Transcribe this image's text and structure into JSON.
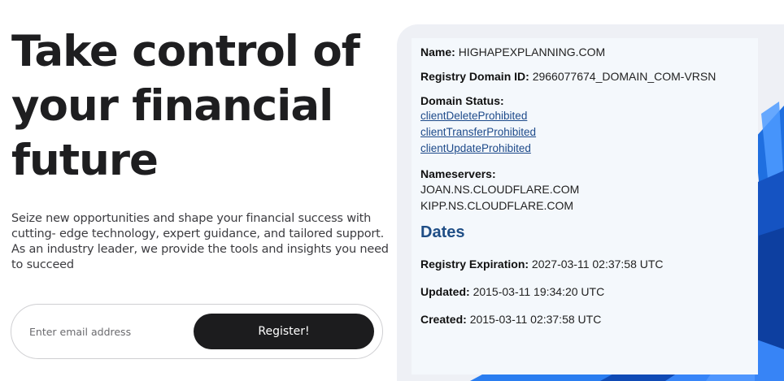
{
  "hero": {
    "title_line1": "Take control of",
    "title_line2": "your financial",
    "title_line3": "future",
    "description": "Seize new opportunities and shape your financial success with cutting- edge technology, expert guidance, and tailored support. As an industry leader, we provide the tools and insights you need to succeed"
  },
  "signup": {
    "email_placeholder": "Enter email address",
    "email_value": "",
    "register_label": "Register!"
  },
  "whois": {
    "name_label": "Name:",
    "name_value": "HIGHAPEXPLANNING.COM",
    "registry_id_label": "Registry Domain ID:",
    "registry_id_value": "2966077674_DOMAIN_COM-VRSN",
    "status_label": "Domain Status:",
    "statuses": [
      "clientDeleteProhibited",
      "clientTransferProhibited",
      "clientUpdateProhibited"
    ],
    "nameservers_label": "Nameservers:",
    "nameservers": [
      "JOAN.NS.CLOUDFLARE.COM",
      "KIPP.NS.CLOUDFLARE.COM"
    ],
    "dates_heading": "Dates",
    "expiration_label": "Registry Expiration:",
    "expiration_value": "2027-03-11 02:37:58 UTC",
    "updated_label": "Updated:",
    "updated_value": "2015-03-11 19:34:20 UTC",
    "created_label": "Created:",
    "created_value": "2015-03-11 02:37:58 UTC"
  },
  "colors": {
    "dark": "#1c1c1e",
    "link": "#1d4a8a",
    "dates_heading": "#1f4e86",
    "panel_background": "#f4f8fc",
    "accent_blue": "#1f6fe0"
  }
}
